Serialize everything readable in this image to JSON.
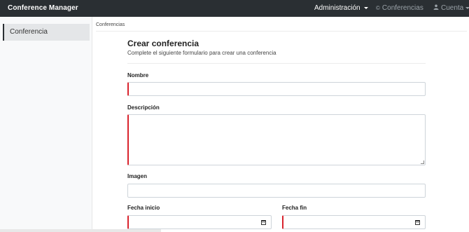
{
  "navbar": {
    "brand": "Conference Manager",
    "admin_label": "Administración",
    "conferences_label": "Conferencias",
    "account_label": "Cuenta",
    "conferences_icon": "copyright-circle-icon",
    "account_icon": "user-icon"
  },
  "sidebar": {
    "items": [
      {
        "label": "Conferencia"
      }
    ]
  },
  "breadcrumb": {
    "current": "Conferencias"
  },
  "form": {
    "title": "Crear conferencia",
    "subtitle": "Complete el siguiente formulario para crear una conferencia",
    "fields": {
      "name": {
        "label": "Nombre",
        "value": ""
      },
      "description": {
        "label": "Descripción",
        "value": ""
      },
      "image": {
        "label": "Imagen",
        "value": ""
      },
      "start_date": {
        "label": "Fecha inicio",
        "value": "",
        "icon": "calendar-icon"
      },
      "end_date": {
        "label": "Fecha fin",
        "value": "",
        "icon": "calendar-icon"
      }
    }
  },
  "colors": {
    "navbar_bg": "#2a2f33",
    "required_marker": "#d9232d",
    "sidebar_active_bg": "#e4e6e8"
  }
}
